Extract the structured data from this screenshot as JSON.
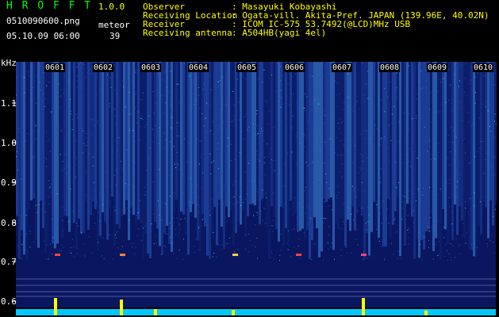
{
  "app": {
    "logo": "H R O F F T",
    "version": "1.0.0"
  },
  "file": {
    "name": "0510090600.png",
    "datetime": "05.10.09 06:00"
  },
  "meteor": {
    "label": "meteor",
    "count": "39"
  },
  "meta": [
    {
      "label": "Observer",
      "value": ": Masayuki Kobayashi"
    },
    {
      "label": "Receiving Location",
      "value": ": Ogata-vill. Akita-Pref. JAPAN (139.96E, 40.02N)"
    },
    {
      "label": "Receiver",
      "value": ": ICOM IC-575 53.7492(@LCD)MHz USB"
    },
    {
      "label": "Receiving antenna",
      "value": ": A504HB(yagi 4el)"
    }
  ],
  "axis": {
    "unit": "kHz",
    "y_ticks": [
      "1.1",
      "1.0",
      "0.9",
      "0.8",
      "0.7",
      "0.6"
    ],
    "time_ticks": [
      "0601",
      "0602",
      "0603",
      "0604",
      "0605",
      "0606",
      "0607",
      "0608",
      "0609",
      "0610"
    ]
  },
  "colors": {
    "green": "#00ff00",
    "yellow": "#ffff00",
    "cyan": "#00ffff",
    "bg": "#000000"
  }
}
